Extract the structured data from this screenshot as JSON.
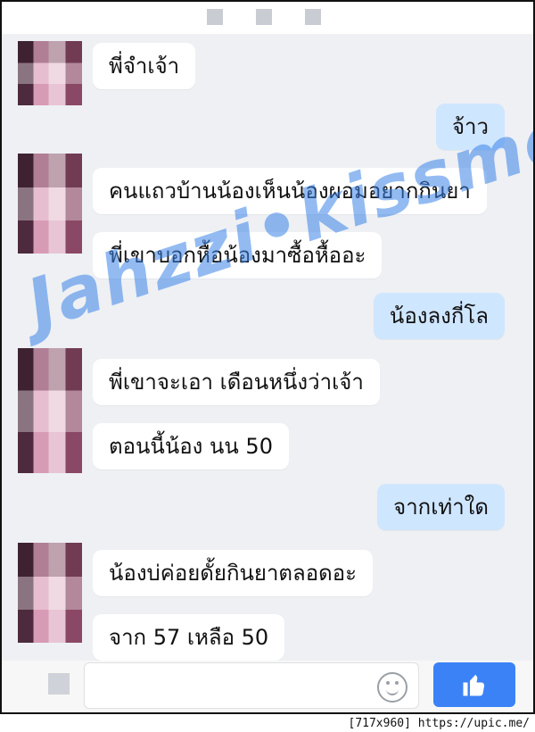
{
  "messages": [
    {
      "side": "in",
      "text": "พี่จำเจ้า"
    },
    {
      "side": "out",
      "text": "จ้าว"
    },
    {
      "side": "in",
      "text": "คนแถวบ้านน้องเห็นน้องผอมอยากกินยา"
    },
    {
      "side": "in",
      "text": "พี่เขาบอกหื้อน้องมาซื้อหื้ออะ"
    },
    {
      "side": "out",
      "text": "น้องลงกี่โล"
    },
    {
      "side": "in",
      "text": "พี่เขาจะเอา เดือนหนึ่งว่าเจ้า"
    },
    {
      "side": "in",
      "text": "ตอนนี้น้อง นน 50"
    },
    {
      "side": "out",
      "text": "จากเท่าใด"
    },
    {
      "side": "in",
      "text": "น้องบ่ค่อยดั้ยกินยาตลอดอะ"
    },
    {
      "side": "in",
      "text": "จาก 57 เหลือ 50"
    }
  ],
  "watermark": "Jahzzi•kissme",
  "footer": "[717x960] https://upic.me/",
  "icons": {
    "emoji": "smile-icon",
    "like": "thumbs-up-icon"
  },
  "colors": {
    "incoming": "#ffffff",
    "outgoing": "#cfe6ff",
    "like": "#3b82f6",
    "watermark": "#3b84e7"
  }
}
